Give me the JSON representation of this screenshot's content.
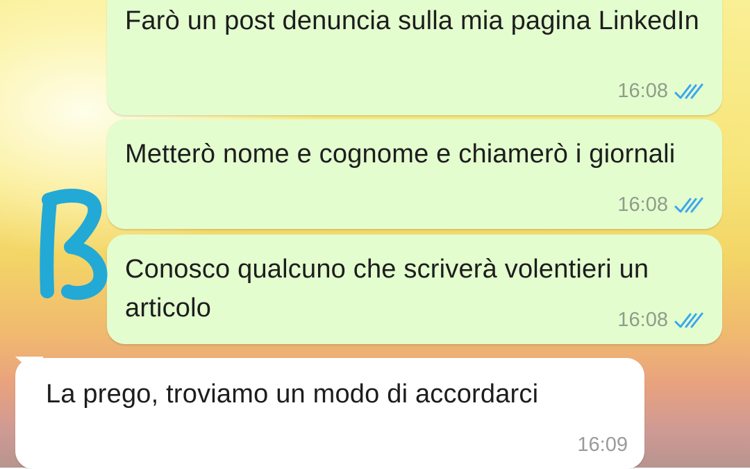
{
  "colors": {
    "outgoing_bubble": "#e3fdcf",
    "incoming_bubble": "#ffffff",
    "read_ticks": "#3aa6ee",
    "scribble": "#22a9d6"
  },
  "messages": [
    {
      "direction": "outgoing",
      "text": "Farò un post denuncia sulla mia pagina LinkedIn",
      "time": "16:08",
      "status_icon": "double-check-read-icon"
    },
    {
      "direction": "outgoing",
      "text": "Metterò nome e cognome e chiamerò i giornali",
      "time": "16:08",
      "status_icon": "double-check-read-icon"
    },
    {
      "direction": "outgoing",
      "text": "Conosco qualcuno che scriverà volentieri un articolo",
      "time": "16:08",
      "status_icon": "double-check-read-icon"
    },
    {
      "direction": "incoming",
      "text": "La prego, troviamo un modo di accordarci",
      "time": "16:09"
    }
  ],
  "annotation": {
    "icon": "handwritten-b-scribble"
  }
}
